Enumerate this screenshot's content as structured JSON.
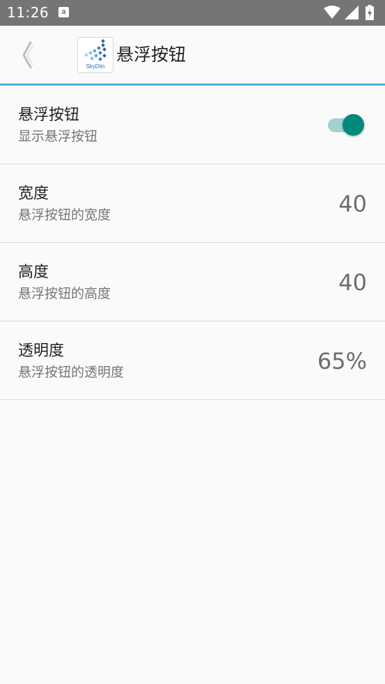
{
  "status_bar": {
    "time": "11:26",
    "notification_icon": "a",
    "icons": [
      "wifi-icon",
      "signal-icon",
      "battery-charging-icon"
    ]
  },
  "app_bar": {
    "back_icon": "chevron-left-icon",
    "logo_text": "SkyDlin",
    "title": "悬浮按钮",
    "accent_color": "#4aaed9"
  },
  "settings": [
    {
      "title": "悬浮按钮",
      "summary": "显示悬浮按钮",
      "type": "switch",
      "checked": true
    },
    {
      "title": "宽度",
      "summary": "悬浮按钮的宽度",
      "type": "value",
      "value": "40"
    },
    {
      "title": "高度",
      "summary": "悬浮按钮的高度",
      "type": "value",
      "value": "40"
    },
    {
      "title": "透明度",
      "summary": "悬浮按钮的透明度",
      "type": "value",
      "value": "65%"
    }
  ],
  "colors": {
    "status_bar": "#757575",
    "switch_on_thumb": "#00897b",
    "switch_on_track": "#a3d2ce",
    "divider": "#d9d9d9",
    "background": "#fafafa"
  }
}
